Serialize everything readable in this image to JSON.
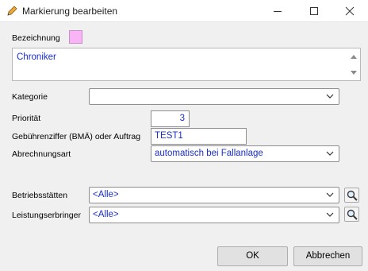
{
  "window": {
    "title": "Markierung bearbeiten"
  },
  "form": {
    "bezeichnung_label": "Bezeichnung",
    "bezeichnung_color": "#f8b4f4",
    "bezeichnung_value": "Chroniker",
    "kategorie_label": "Kategorie",
    "kategorie_value": "",
    "prioritaet_label": "Priorität",
    "prioritaet_value": "3",
    "gebuehr_label": "Gebührenziffer (BMÄ) oder Auftrag",
    "gebuehr_value": "TEST1",
    "abrechnungsart_label": "Abrechnungsart",
    "abrechnungsart_value": "automatisch bei Fallanlage",
    "betriebsstaetten_label": "Betriebsstätten",
    "betriebsstaetten_value": "<Alle>",
    "leistungserbringer_label": "Leistungserbringer",
    "leistungserbringer_value": "<Alle>"
  },
  "buttons": {
    "ok": "OK",
    "cancel": "Abbrechen"
  },
  "colors": {
    "value_text": "#1a2ecc"
  }
}
